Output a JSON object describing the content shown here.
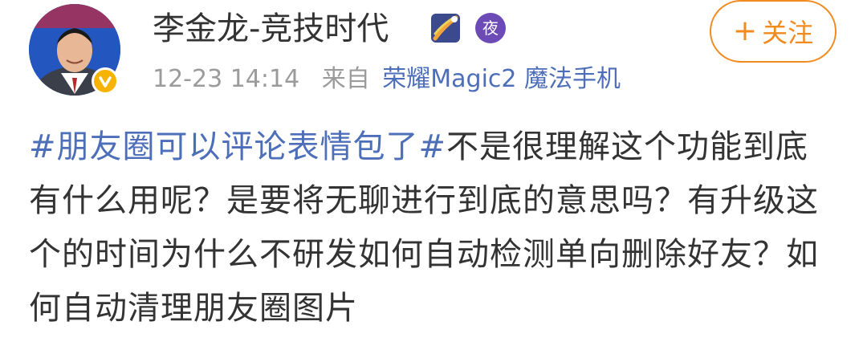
{
  "post": {
    "username": "李金龙-竞技时代",
    "badge_night_text": "夜",
    "follow_button": {
      "icon": "plus-icon",
      "label": "关注"
    },
    "meta": {
      "time": "12-23 14:14",
      "from_label": "来自",
      "source": "荣耀Magic2 魔法手机"
    },
    "content": {
      "topic": "#朋友圈可以评论表情包了#",
      "text": "不是很理解这个功能到底有什么用呢？是要将无聊进行到底的意思吗？有升级这个的时间为什么不研发如何自动检测单向删除好友？如何自动清理朋友圈图片"
    },
    "colors": {
      "link": "#4d6eb8",
      "follow": "#f28a1e",
      "verified": "#f6b400",
      "meta": "#9b9b9b",
      "text": "#333333"
    }
  }
}
